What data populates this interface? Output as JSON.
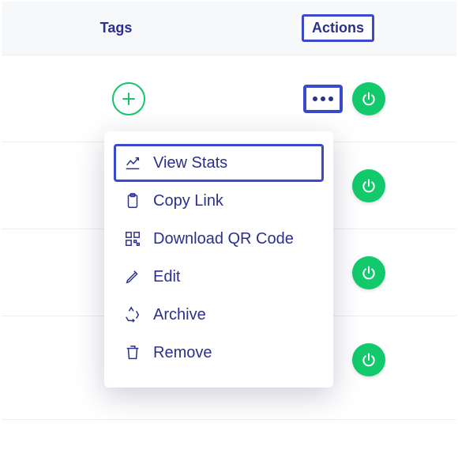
{
  "header": {
    "tags_label": "Tags",
    "actions_label": "Actions"
  },
  "menu": {
    "view_stats": "View Stats",
    "copy_link": "Copy Link",
    "download_qr": "Download QR Code",
    "edit": "Edit",
    "archive": "Archive",
    "remove": "Remove"
  }
}
